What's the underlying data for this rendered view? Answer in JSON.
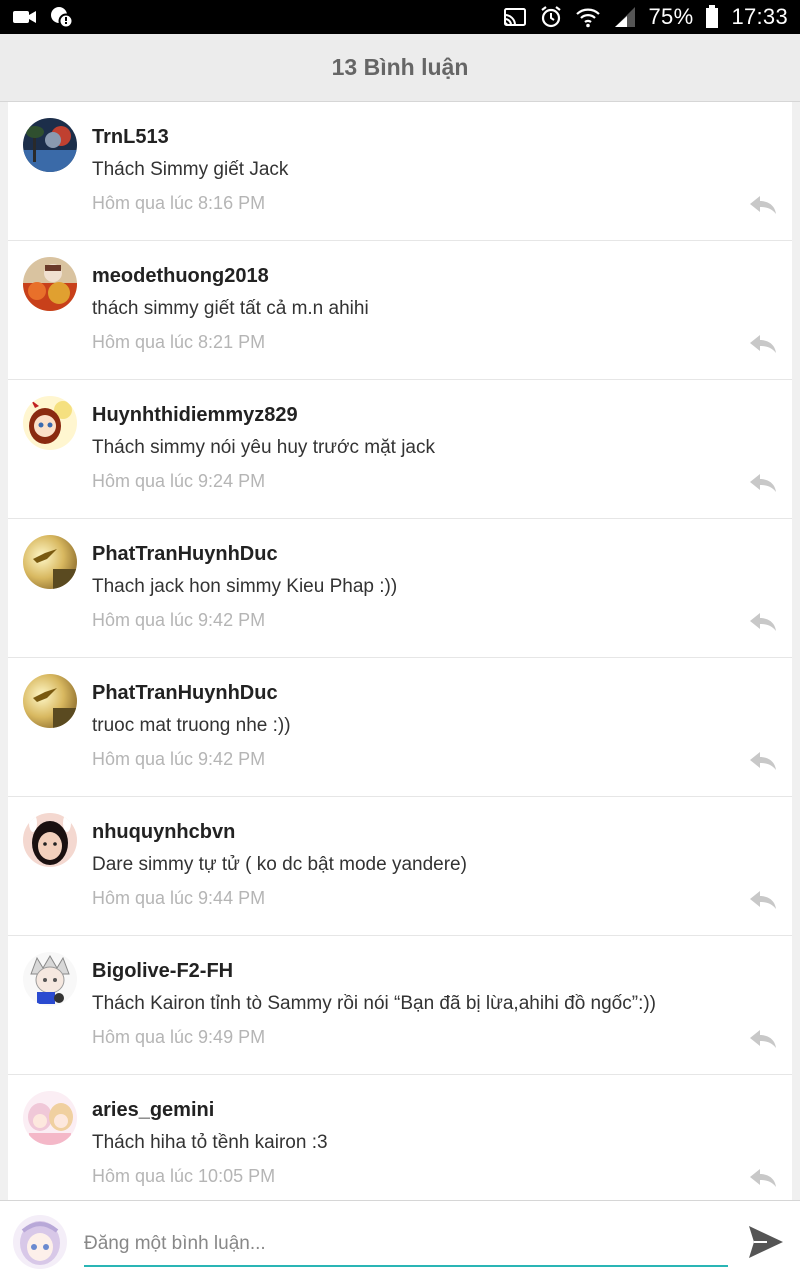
{
  "status_bar": {
    "battery": "75%",
    "time": "17:33",
    "icons": [
      "video-camera-icon",
      "notification-icon",
      "cast-icon",
      "alarm-icon",
      "wifi-icon",
      "signal-icon",
      "battery-icon"
    ]
  },
  "header": {
    "title": "13 Bình luận"
  },
  "comments": [
    {
      "user": "TrnL513",
      "text": "Thách Simmy giết Jack",
      "time": "Hôm qua lúc 8:16 PM"
    },
    {
      "user": "meodethuong2018",
      "text": "thách simmy giết tất cả m.n ahihi",
      "time": "Hôm qua lúc 8:21 PM"
    },
    {
      "user": "Huynhthidiemmyz829",
      "text": "Thách simmy nói yêu huy trước mặt jack",
      "time": "Hôm qua lúc 9:24 PM"
    },
    {
      "user": "PhatTranHuynhDuc",
      "text": "Thach jack hon simmy Kieu Phap :))",
      "time": "Hôm qua lúc 9:42 PM"
    },
    {
      "user": "PhatTranHuynhDuc",
      "text": "truoc mat truong nhe :))",
      "time": "Hôm qua lúc 9:42 PM"
    },
    {
      "user": "nhuquynhcbvn",
      "text": "Dare simmy tự tử ( ko dc bật mode yandere)",
      "time": "Hôm qua lúc 9:44 PM"
    },
    {
      "user": "Bigolive-F2-FH",
      "text": "Thách Kairon tỉnh tò Sammy rồi nói “Bạn đã bị lừa,ahihi đồ ngốc”:))",
      "time": "Hôm qua lúc 9:49 PM"
    },
    {
      "user": "aries_gemini",
      "text": "Thách hiha tỏ tềnh kairon :3",
      "time": "Hôm qua lúc 10:05 PM"
    }
  ],
  "input": {
    "placeholder": "Đăng một bình luận..."
  },
  "colors": {
    "accent": "#2ab5b5",
    "header_bg": "#ececec",
    "timestamp": "#b5b5b5"
  }
}
